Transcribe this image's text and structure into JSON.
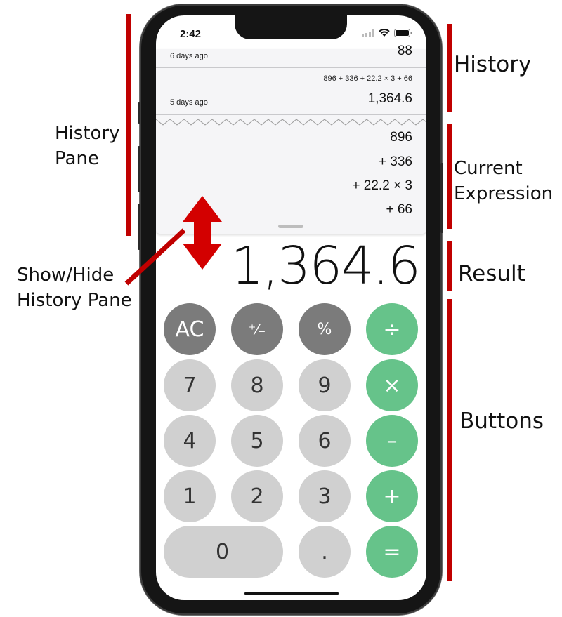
{
  "status_bar": {
    "time": "2:42"
  },
  "history": {
    "entries": [
      {
        "date": "6 days ago",
        "expression": "",
        "result": "88"
      },
      {
        "date": "5 days ago",
        "expression": "896 + 336 + 22.2 × 3 + 66",
        "result": "1,364.6"
      }
    ]
  },
  "current_expression": [
    "896",
    "+ 336",
    "+ 22.2 × 3",
    "+ 66"
  ],
  "result": "1,364.6",
  "buttons": {
    "ac": "AC",
    "plus_minus": "⁺⁄₋",
    "percent": "%",
    "divide": "÷",
    "seven": "7",
    "eight": "8",
    "nine": "9",
    "multiply": "×",
    "four": "4",
    "five": "5",
    "six": "6",
    "minus": "–",
    "one": "1",
    "two": "2",
    "three": "3",
    "plus": "+",
    "zero": "0",
    "decimal": ".",
    "equals": "="
  },
  "annotations": {
    "history_pane": "History\nPane",
    "show_hide": "Show/Hide\nHistory Pane",
    "history": "History",
    "current_expression": "Current\nExpression",
    "result": "Result",
    "buttons": "Buttons"
  },
  "colors": {
    "annotation_red": "#c00000",
    "function_key": "#7b7b7b",
    "number_key": "#d0d0d0",
    "operator_key": "#66c38a"
  }
}
